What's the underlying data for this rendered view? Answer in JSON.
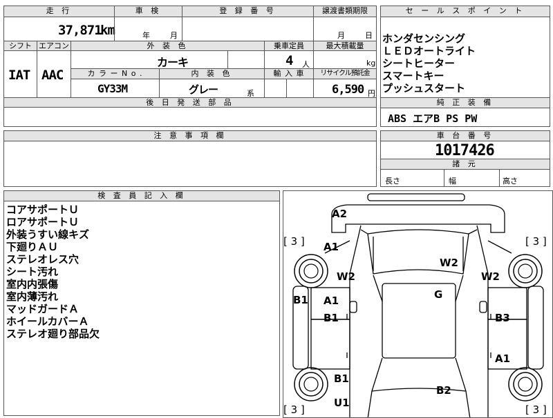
{
  "header": {
    "mileage_label": "走 行",
    "inspection_label": "車 検",
    "registration_label": "登 録 番 号",
    "transfer_deadline_label": "譲渡書類期限",
    "mileage_value": "37,871",
    "mileage_unit": "km",
    "inspection_year": "年",
    "inspection_month": "月",
    "transfer_month": "月",
    "transfer_day": "日"
  },
  "spec": {
    "shift_label": "シフト",
    "ac_label": "エアコン",
    "exterior_label": "外 装 色",
    "seats_label": "乗車定員",
    "max_load_label": "最大積載量",
    "shift_value": "IAT",
    "ac_value": "AAC",
    "exterior_value": "カーキ",
    "seats_value": "4",
    "seats_unit": "人",
    "load_unit": "kg",
    "color_no_label": "カ ラ ー  N o .",
    "interior_label": "内 装 色",
    "import_label": "輸 入 車",
    "recycle_label": "リサイクル預託金",
    "color_no_value": "GY33M",
    "interior_value": "グレー",
    "interior_suffix": "系",
    "recycle_value": "6,590",
    "recycle_unit": "円"
  },
  "post_parts": {
    "label": "後 日 発 送 部 品"
  },
  "notes": {
    "label": "注 意 事 項 欄"
  },
  "sales_points": {
    "label": "セ ー ル ス ポ イ ン ト",
    "items": [
      "ホンダセンシング",
      "ＬＥＤオートライト",
      "シートヒーター",
      "スマートキー",
      "プッシュスタート"
    ]
  },
  "equipment": {
    "label": "純 正 装 備",
    "value": "ABS エアB PS PW"
  },
  "chassis": {
    "label": "車 台 番 号",
    "value": "1017426"
  },
  "dimensions": {
    "label": "諸 元",
    "length": "長さ",
    "width": "幅",
    "height": "高さ"
  },
  "inspector": {
    "label": "検 査 員 記 入 欄",
    "items": [
      "コアサポートＵ",
      "ロアサポートＵ",
      "外装うすい線キズ",
      "下廻りＡＵ",
      "ステレオレス穴",
      "シート汚れ",
      "室内内張傷",
      "室内薄汚れ",
      "マッドガードＡ",
      "ホイールカバーＡ",
      "ステレオ廻り部品欠"
    ]
  },
  "diagram": {
    "tire_fl": "[ 3 ]",
    "tire_fr": "[ 3 ]",
    "tire_rl": "[ 3 ]",
    "tire_rr": "[ 3 ]",
    "a2_top": "A2",
    "a1_fender": "A1",
    "w2_left": "W2",
    "w2_windshield": "W2",
    "w2_right": "W2",
    "g_roof": "G",
    "b1_left_side": "B1",
    "a1_door": "A1",
    "b1_door": "B1",
    "b3_right_door": "B3",
    "a1_right_quarter": "A1",
    "b1_rear": "B1",
    "b2_rear": "B2",
    "u1_rear": "U1"
  }
}
